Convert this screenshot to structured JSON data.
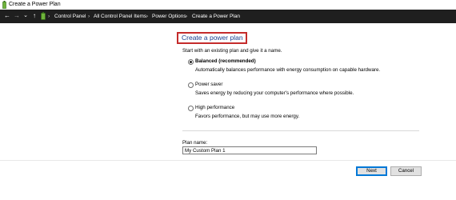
{
  "window": {
    "title": "Create a Power Plan"
  },
  "address": {
    "back_glyph": "←",
    "forward_glyph": "→",
    "dropdown_glyph": "⌄",
    "up_glyph": "↑",
    "crumb_sep": "›",
    "breadcrumbs": [
      "Control Panel",
      "All Control Panel Items",
      "Power Options",
      "Create a Power Plan"
    ]
  },
  "main": {
    "heading": "Create a power plan",
    "intro": "Start with an existing plan and give it a name.",
    "options": [
      {
        "label": "Balanced (recommended)",
        "desc": "Automatically balances performance with energy consumption on capable hardware.",
        "selected": true
      },
      {
        "label": "Power saver",
        "desc": "Saves energy by reducing your computer's performance where possible.",
        "selected": false
      },
      {
        "label": "High performance",
        "desc": "Favors performance, but may use more energy.",
        "selected": false
      }
    ],
    "plan_name_label": "Plan name:",
    "plan_name_value": "My Custom Plan 1"
  },
  "buttons": {
    "next": "Next",
    "cancel": "Cancel"
  },
  "colors": {
    "heading": "#1a3e8f",
    "highlight_box": "#c42b2b",
    "address_bg": "#1f1f1f"
  }
}
